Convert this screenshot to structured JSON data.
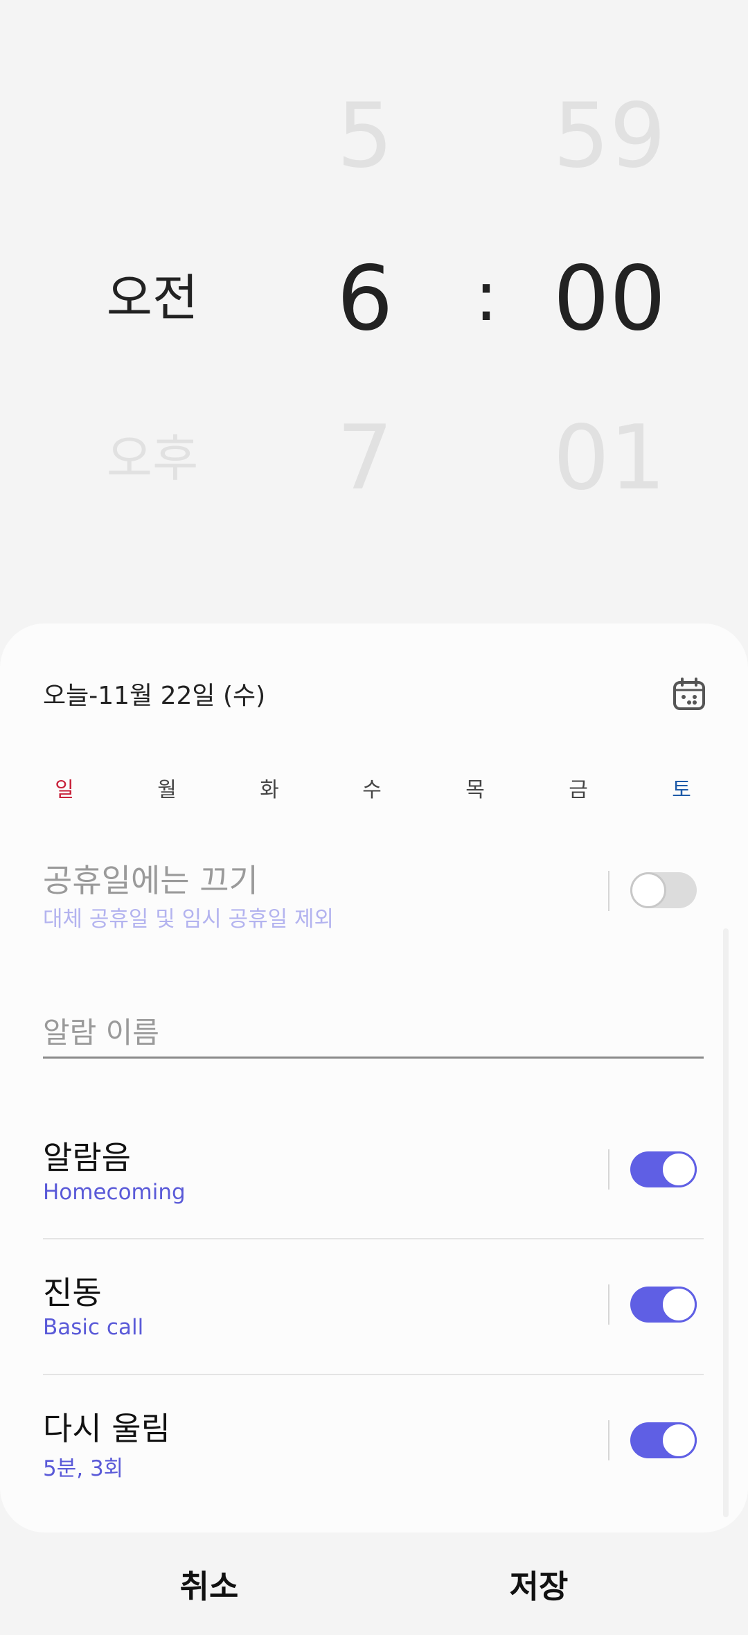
{
  "picker": {
    "ampm_selected": "오전",
    "ampm_other": "오후",
    "hour_prev": "5",
    "hour": "6",
    "hour_next": "7",
    "separator": ":",
    "minute_prev": "59",
    "minute": "00",
    "minute_next": "01"
  },
  "date": {
    "label": "오늘-11월 22일 (수)",
    "icon": "calendar-icon"
  },
  "weekdays": [
    {
      "label": "일",
      "color": "#c8213a"
    },
    {
      "label": "월",
      "color": "#444444"
    },
    {
      "label": "화",
      "color": "#444444"
    },
    {
      "label": "수",
      "color": "#444444"
    },
    {
      "label": "목",
      "color": "#444444"
    },
    {
      "label": "금",
      "color": "#444444"
    },
    {
      "label": "토",
      "color": "#1e5aa8"
    }
  ],
  "holiday": {
    "title": "공휴일에는 끄기",
    "subtitle": "대체 공휴일 및 임시 공휴일 제외",
    "enabled": false
  },
  "alarm_name": {
    "placeholder": "알람 이름",
    "value": ""
  },
  "settings": [
    {
      "title": "알람음",
      "subtitle": "Homecoming",
      "enabled": true
    },
    {
      "title": "진동",
      "subtitle": "Basic call",
      "enabled": true
    },
    {
      "title": "다시 울림",
      "subtitle": "5분, 3회",
      "enabled": true
    }
  ],
  "actions": {
    "cancel": "취소",
    "save": "저장"
  },
  "colors": {
    "accent": "#5f5fe4",
    "sunday": "#c8213a",
    "saturday": "#1e5aa8"
  }
}
